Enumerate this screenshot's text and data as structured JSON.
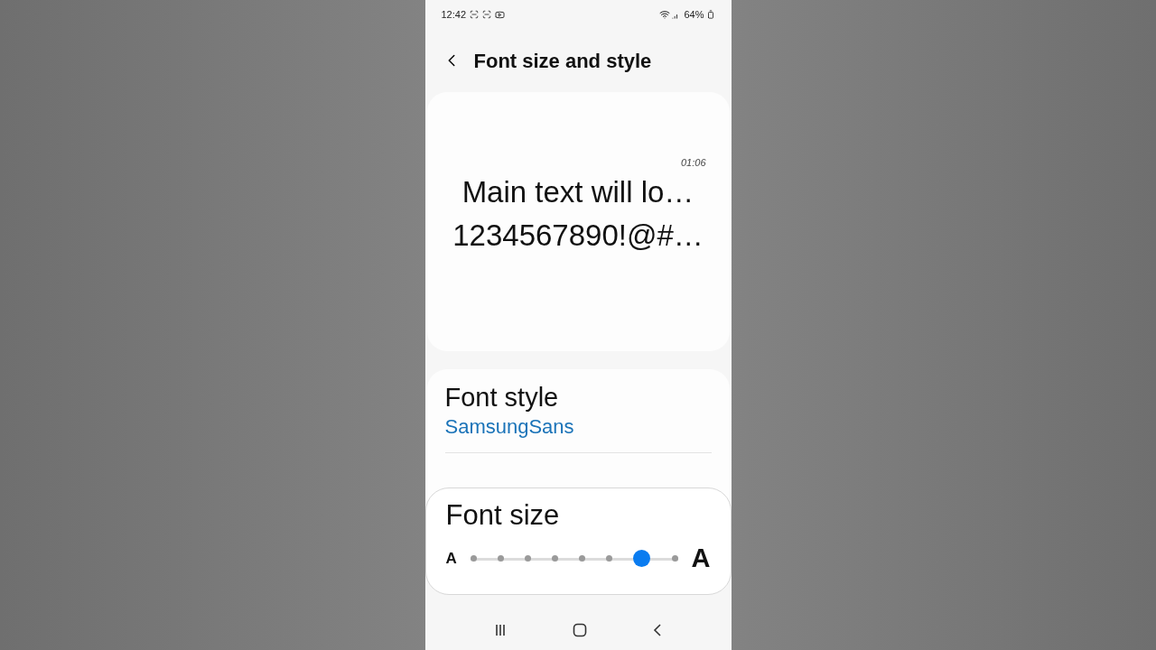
{
  "status_bar": {
    "time": "12:42",
    "battery": "64%"
  },
  "header": {
    "title": "Font size and style"
  },
  "preview": {
    "time": "01:06",
    "lines": [
      "Main text will lo…",
      "1234567890!@#…"
    ]
  },
  "settings": [
    {
      "title": "Font style",
      "value": "SamsungSans"
    }
  ],
  "font_size_sheet": {
    "title": "Font size",
    "small_label": "A",
    "large_label": "A",
    "level": 0.857
  }
}
